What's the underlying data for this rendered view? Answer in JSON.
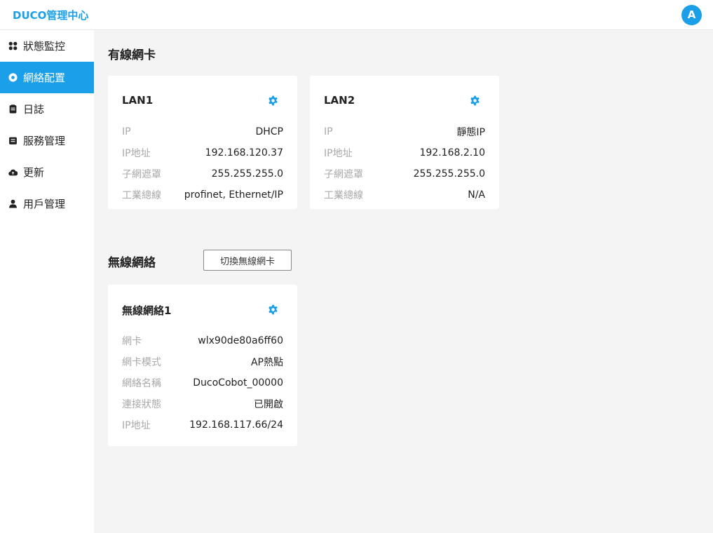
{
  "app": {
    "title": "DUCO管理中心",
    "avatar": "A",
    "accent": "#1a9fe8"
  },
  "sidebar": {
    "items": [
      {
        "label": "狀態監控",
        "icon": "dashboard-icon",
        "active": false
      },
      {
        "label": "網絡配置",
        "icon": "network-icon",
        "active": true
      },
      {
        "label": "日誌",
        "icon": "log-icon",
        "active": false
      },
      {
        "label": "服務管理",
        "icon": "service-icon",
        "active": false
      },
      {
        "label": "更新",
        "icon": "cloud-icon",
        "active": false
      },
      {
        "label": "用戶管理",
        "icon": "user-icon",
        "active": false
      }
    ]
  },
  "wired": {
    "title": "有線網卡",
    "cards": [
      {
        "title": "LAN1",
        "rows": [
          {
            "k": "IP",
            "v": "DHCP"
          },
          {
            "k": "IP地址",
            "v": "192.168.120.37"
          },
          {
            "k": "子網遮罩",
            "v": "255.255.255.0"
          },
          {
            "k": "工業總線",
            "v": "profinet, Ethernet/IP"
          }
        ]
      },
      {
        "title": "LAN2",
        "rows": [
          {
            "k": "IP",
            "v": "靜態IP"
          },
          {
            "k": "IP地址",
            "v": "192.168.2.10"
          },
          {
            "k": "子網遮罩",
            "v": "255.255.255.0"
          },
          {
            "k": "工業總線",
            "v": "N/A"
          }
        ]
      }
    ]
  },
  "wireless": {
    "title": "無線網絡",
    "switch_label": "切換無線網卡",
    "card": {
      "title": "無線網絡1",
      "rows": [
        {
          "k": "網卡",
          "v": "wlx90de80a6ff60"
        },
        {
          "k": "網卡模式",
          "v": "AP熱點"
        },
        {
          "k": "網絡名稱",
          "v": "DucoCobot_00000"
        },
        {
          "k": "連接狀態",
          "v": "已開啟"
        },
        {
          "k": "IP地址",
          "v": "192.168.117.66/24"
        }
      ]
    }
  }
}
